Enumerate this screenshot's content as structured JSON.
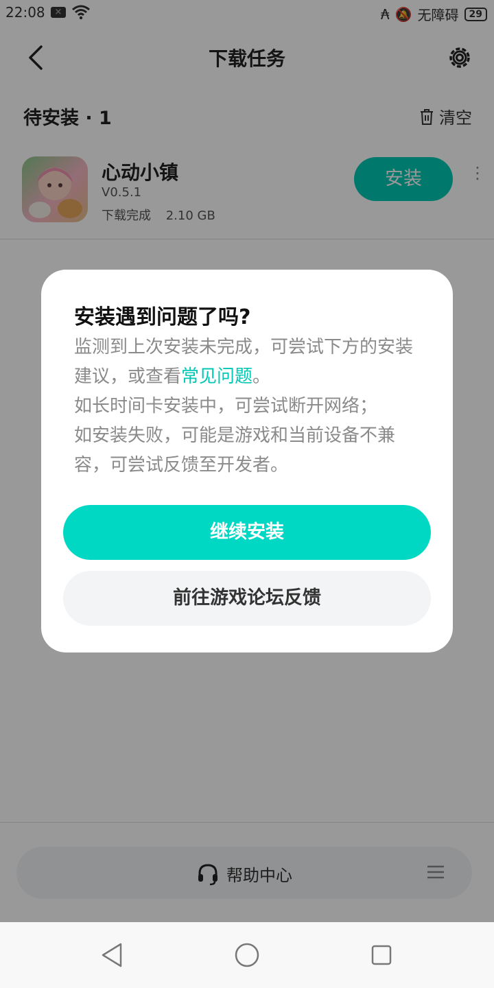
{
  "status_bar": {
    "time": "22:08",
    "accessibility": "无障碍",
    "battery": "29"
  },
  "header": {
    "title": "下载任务"
  },
  "section": {
    "title": "待安装 · 1",
    "clear_label": "清空"
  },
  "app": {
    "name": "心动小镇",
    "version": "V0.5.1",
    "status": "下载完成",
    "size": "2.10 GB",
    "install_label": "安装",
    "more": "⋮"
  },
  "dialog": {
    "title": "安装遇到问题了吗?",
    "body_part1": "监测到上次安装未完成，可尝试下方的安装建议，或查看",
    "link": "常见问题",
    "body_part2": "。",
    "line2": "如长时间卡安装中，可尝试断开网络；",
    "line3": "如安装失败，可能是游戏和当前设备不兼容，可尝试反馈至开发者。",
    "primary_button": "继续安装",
    "secondary_button": "前往游戏论坛反馈"
  },
  "help_bar": {
    "label": "帮助中心"
  },
  "colors": {
    "accent": "#00d8c4",
    "install_button": "#00c8b4"
  }
}
